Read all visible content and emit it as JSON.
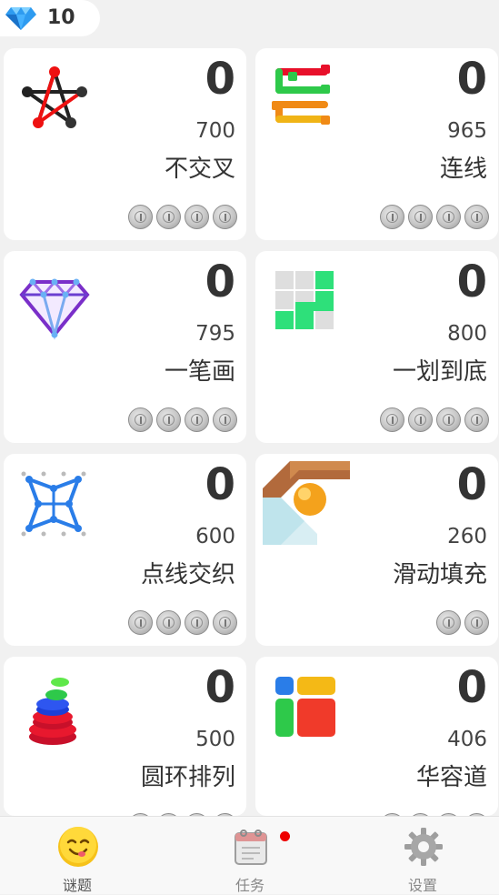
{
  "header": {
    "gems": "10"
  },
  "levels": [
    {
      "name": "不交叉",
      "score": "0",
      "best": "700",
      "coins": 4
    },
    {
      "name": "连线",
      "score": "0",
      "best": "965",
      "coins": 4
    },
    {
      "name": "一笔画",
      "score": "0",
      "best": "795",
      "coins": 4
    },
    {
      "name": "一划到底",
      "score": "0",
      "best": "800",
      "coins": 4
    },
    {
      "name": "点线交织",
      "score": "0",
      "best": "600",
      "coins": 4
    },
    {
      "name": "滑动填充",
      "score": "0",
      "best": "260",
      "coins": 2
    },
    {
      "name": "圆环排列",
      "score": "0",
      "best": "500",
      "coins": 4
    },
    {
      "name": "华容道",
      "score": "0",
      "best": "406",
      "coins": 4
    }
  ],
  "tabs": {
    "puzzles": "谜题",
    "tasks": "任务",
    "settings": "设置"
  },
  "colors": {
    "accent": "#e00000",
    "card": "#ffffff",
    "background": "#f1f1f1"
  }
}
